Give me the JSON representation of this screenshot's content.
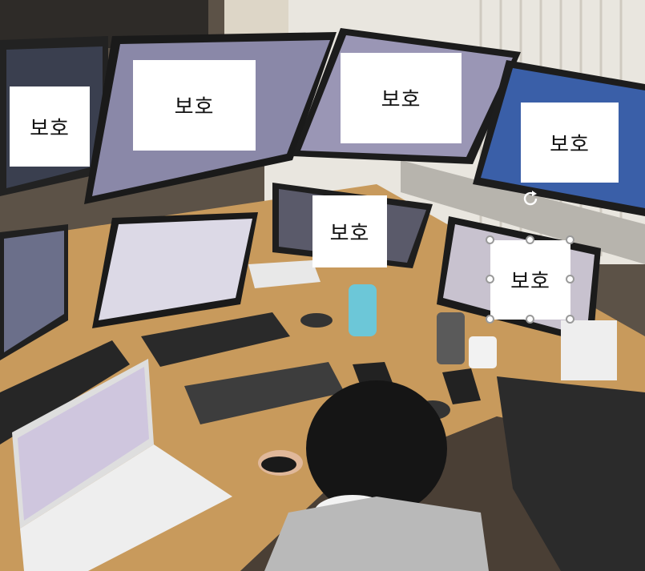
{
  "masks": [
    {
      "id": "mask-left-monitor",
      "label": "보호"
    },
    {
      "id": "mask-center-left-monitor",
      "label": "보호"
    },
    {
      "id": "mask-center-monitor",
      "label": "보호"
    },
    {
      "id": "mask-right-monitor",
      "label": "보호"
    },
    {
      "id": "mask-small-monitor",
      "label": "보호"
    },
    {
      "id": "mask-selected",
      "label": "보호"
    }
  ],
  "colors": {
    "mask_bg": "#ffffff",
    "mask_text": "#111111",
    "handle_border": "#9a9a9a"
  }
}
